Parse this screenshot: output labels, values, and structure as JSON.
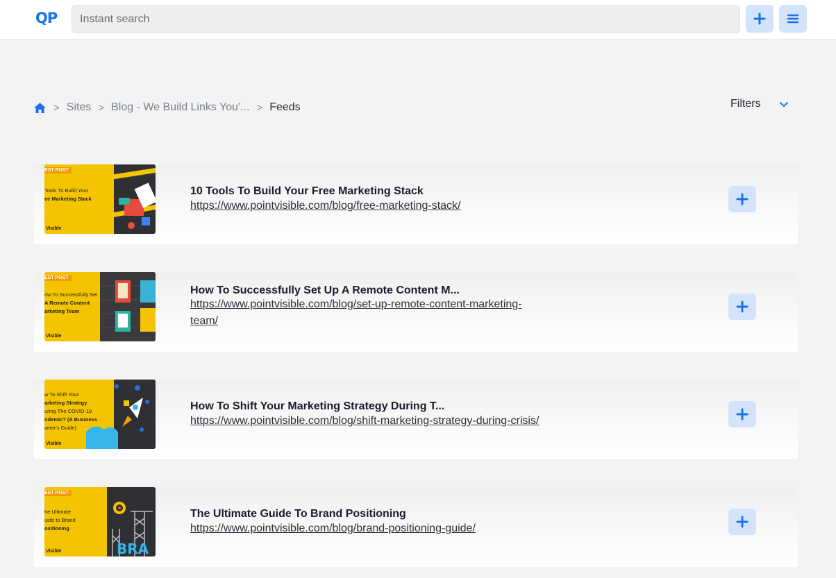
{
  "header": {
    "logo": "QP",
    "search_placeholder": "Instant search",
    "add_button_icon": "plus-icon",
    "menu_button_icon": "hamburger-menu-icon"
  },
  "breadcrumb": {
    "home_icon": "home-icon",
    "items": [
      "Sites",
      "Blog - We Build Links You'...",
      "Feeds"
    ],
    "separator": ">"
  },
  "filters": {
    "label": "Filters",
    "icon": "chevron-down-icon"
  },
  "feeds": [
    {
      "title": "10 Tools To Build Your Free Marketing Stack",
      "url_lines": [
        "https://www.pointvisible.com/blog/free-marketing-stack/"
      ],
      "thumb": {
        "tag": "EST POST",
        "lines": [
          "Tools To Build Your",
          "ee Marketing Stack"
        ],
        "brand": "Visible"
      }
    },
    {
      "title": "How To Successfully Set Up A Remote Content M...",
      "url_lines": [
        "https://www.pointvisible.com/blog/set-up-remote-content-marketing-",
        "team/"
      ],
      "thumb": {
        "tag": "EST POST",
        "lines": [
          "ow To Successfully Set",
          "A Remote Content",
          "arketing Team"
        ],
        "brand": "Visible"
      }
    },
    {
      "title": "How To Shift Your Marketing Strategy During T...",
      "url_lines": [
        "https://www.pointvisible.com/blog/shift-marketing-strategy-during-crisis/"
      ],
      "thumb": {
        "tag": "",
        "lines": [
          "w To Shift Your",
          "arketing Strategy",
          "uring The COVID-19",
          "ndemic? (A Business",
          "wner's Guide)"
        ],
        "brand": "Visible"
      }
    },
    {
      "title": "The Ultimate Guide To Brand Positioning",
      "url_lines": [
        "https://www.pointvisible.com/blog/brand-positioning-guide/"
      ],
      "thumb": {
        "tag": "EST POST",
        "lines": [
          "he Ultimate",
          "uide to Brand",
          "ositioning"
        ],
        "brand": "Visible"
      }
    }
  ],
  "colors": {
    "accent": "#1a73e8",
    "button_bg": "#d3e3fb",
    "thumb_yellow": "#f5c400"
  }
}
